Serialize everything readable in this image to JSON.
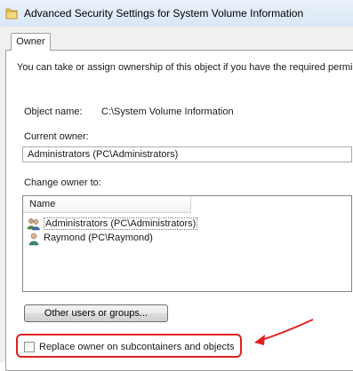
{
  "window": {
    "title": "Advanced Security Settings for System Volume Information"
  },
  "tabs": [
    {
      "label": "Owner"
    }
  ],
  "owner": {
    "intro_text": "You can take or assign ownership of this object if you have the required permis",
    "object_name_label": "Object name:",
    "object_name_value": "C:\\System Volume Information",
    "current_owner_label": "Current owner:",
    "current_owner_value": "Administrators (PC\\Administrators)",
    "change_owner_label": "Change owner to:",
    "list": {
      "column_header": "Name",
      "items": [
        {
          "label": "Administrators (PC\\Administrators)",
          "icon": "group-users-icon",
          "selected": true
        },
        {
          "label": "Raymond (PC\\Raymond)",
          "icon": "user-icon",
          "selected": false
        }
      ]
    },
    "other_users_button": "Other users or groups...",
    "replace_owner_checkbox": {
      "label": "Replace owner on subcontainers and objects",
      "checked": false
    }
  },
  "annotation": {
    "color": "#e02020"
  }
}
